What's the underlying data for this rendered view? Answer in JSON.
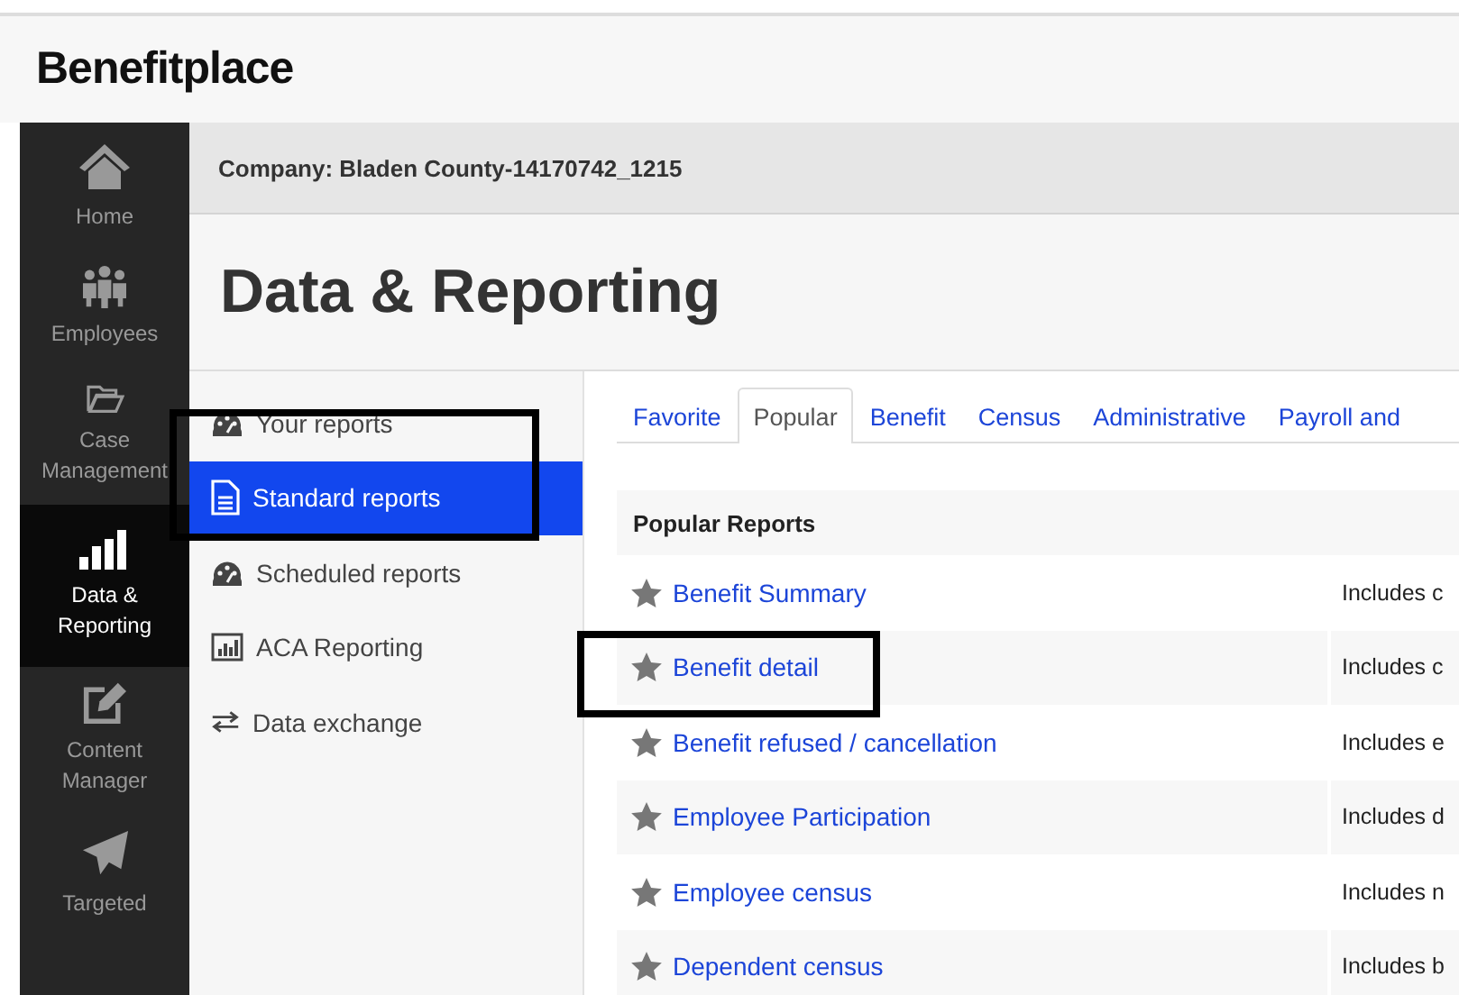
{
  "logo": "Benefitplace",
  "nav": [
    {
      "label": "Home",
      "kind": "home",
      "selected": false
    },
    {
      "label": "Employees",
      "kind": "people",
      "selected": false
    },
    {
      "label": "Case Management",
      "kind": "folder",
      "selected": false
    },
    {
      "label": "Data & Reporting",
      "kind": "bars",
      "selected": true
    },
    {
      "label": "Content Manager",
      "kind": "edit",
      "selected": false
    },
    {
      "label": "Targeted",
      "kind": "plane",
      "selected": false
    }
  ],
  "company": "Company: Bladen County-14170742_1215",
  "page_title": "Data & Reporting",
  "subnav": [
    {
      "label": "Your reports",
      "kind": "gauge",
      "selected": false
    },
    {
      "label": "Standard reports",
      "kind": "doc",
      "selected": true
    },
    {
      "label": "Scheduled reports",
      "kind": "gauge",
      "selected": false
    },
    {
      "label": "ACA Reporting",
      "kind": "chart",
      "selected": false
    },
    {
      "label": "Data exchange",
      "kind": "swap",
      "selected": false
    }
  ],
  "tabs": [
    {
      "label": "Favorite",
      "selected": false
    },
    {
      "label": "Popular",
      "selected": true
    },
    {
      "label": "Benefit",
      "selected": false
    },
    {
      "label": "Census",
      "selected": false
    },
    {
      "label": "Administrative",
      "selected": false
    },
    {
      "label": "Payroll and",
      "selected": false
    }
  ],
  "table": {
    "title": "Popular Reports",
    "rows": [
      {
        "name": "Benefit Summary",
        "description": "Includes c"
      },
      {
        "name": "Benefit detail",
        "description": "Includes c"
      },
      {
        "name": "Benefit refused / cancellation",
        "description": "Includes e"
      },
      {
        "name": "Employee Participation",
        "description": "Includes d"
      },
      {
        "name": "Employee census",
        "description": "Includes n"
      },
      {
        "name": "Dependent census",
        "description": "Includes b"
      }
    ]
  }
}
